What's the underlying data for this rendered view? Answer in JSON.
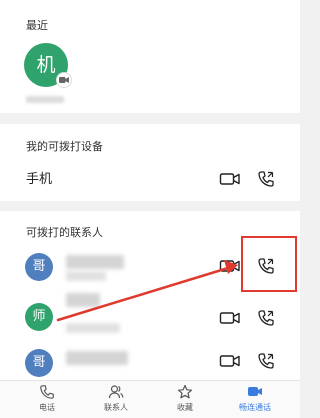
{
  "recent": {
    "title": "最近",
    "avatar_char": "机"
  },
  "devices": {
    "title": "我的可拨打设备",
    "items": [
      {
        "name": "手机"
      }
    ]
  },
  "contacts": {
    "title": "可拨打的联系人",
    "items": [
      {
        "avatar_char": "哥",
        "color": "#4f7fbf"
      },
      {
        "avatar_char": "师",
        "color": "#2fa36b"
      },
      {
        "avatar_char": "哥",
        "color": "#4f7fbf"
      }
    ]
  },
  "bottom_nav": {
    "items": [
      {
        "label": "电话"
      },
      {
        "label": "联系人"
      },
      {
        "label": "收藏"
      },
      {
        "label": "畅连通话"
      }
    ]
  },
  "colors": {
    "accent_green": "#2fa36b",
    "accent_blue": "#4f7fbf",
    "highlight_red": "#e03a2f"
  }
}
